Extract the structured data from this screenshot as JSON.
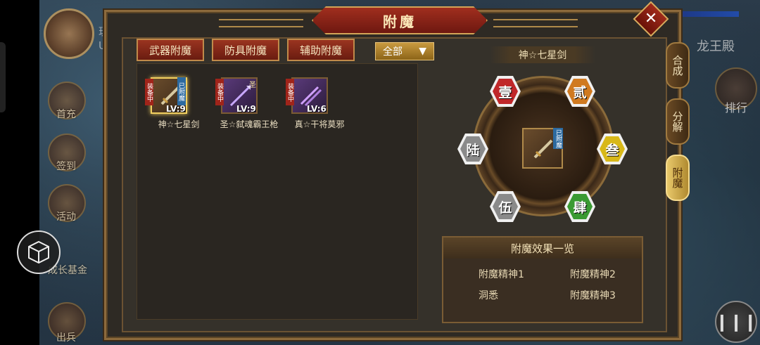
{
  "hud": {
    "player_label": "玩家",
    "uid_label": "UID",
    "location": "龙王殿",
    "rank_label": "排行",
    "left_menu": [
      "首充",
      "签到",
      "活动",
      "成长基金",
      "出兵"
    ]
  },
  "dialog": {
    "title": "附魔",
    "close_icon": "close-icon",
    "tabs": [
      "武器附魔",
      "防具附魔",
      "辅助附魔"
    ],
    "filter": {
      "selected": "全部"
    },
    "items": [
      {
        "name": "神☆七星剑",
        "level": "LV:9",
        "equipped_tag": "装备中",
        "enchant_tag": "已附魔",
        "selected": true
      },
      {
        "name": "圣☆弑魂霸王枪",
        "level": "LV:9",
        "equipped_tag": "装备中",
        "grade_tag": "圣",
        "selected": false
      },
      {
        "name": "真☆干将莫邪",
        "level": "LV:6",
        "equipped_tag": "装备中",
        "selected": false
      }
    ],
    "selected_item_title": "神☆七星剑",
    "center_item_tag": "已附魔",
    "slots": [
      {
        "label": "壹",
        "color": "#c0282a"
      },
      {
        "label": "贰",
        "color": "#d07a20"
      },
      {
        "label": "叁",
        "color": "#d8b818"
      },
      {
        "label": "肆",
        "color": "#3a9a32"
      },
      {
        "label": "伍",
        "color": "#8a8a8a"
      },
      {
        "label": "陆",
        "color": "#8a8a8a"
      }
    ],
    "effects": {
      "header": "附魔效果一览",
      "list": [
        "附魔精神1",
        "附魔精神2",
        "洞悉",
        "附魔精神3"
      ]
    },
    "side_tabs": [
      {
        "label": "合成",
        "active": false
      },
      {
        "label": "分解",
        "active": false
      },
      {
        "label": "附魔",
        "active": true
      }
    ]
  }
}
